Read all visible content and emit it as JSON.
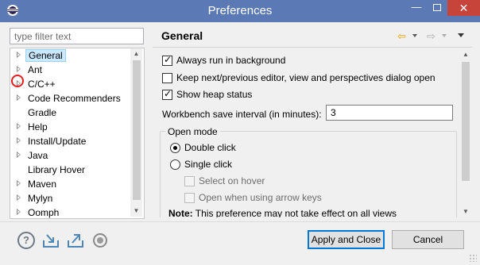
{
  "window": {
    "title": "Preferences",
    "minimize": "—",
    "close": "✕"
  },
  "filter": {
    "placeholder": "type filter text"
  },
  "tree": {
    "items": [
      {
        "label": "General",
        "expandable": true,
        "selected": true
      },
      {
        "label": "Ant",
        "expandable": true
      },
      {
        "label": "C/C++",
        "expandable": true
      },
      {
        "label": "Code Recommenders",
        "expandable": true
      },
      {
        "label": "Gradle",
        "expandable": false
      },
      {
        "label": "Help",
        "expandable": true
      },
      {
        "label": "Install/Update",
        "expandable": true
      },
      {
        "label": "Java",
        "expandable": true
      },
      {
        "label": "Library Hover",
        "expandable": false
      },
      {
        "label": "Maven",
        "expandable": true
      },
      {
        "label": "Mylyn",
        "expandable": true
      },
      {
        "label": "Oomph",
        "expandable": true
      }
    ]
  },
  "page": {
    "title": "General",
    "back_icon": "⇦",
    "forward_icon": "⇨",
    "options": {
      "always_run_background": {
        "label": "Always run in background",
        "checked": true
      },
      "keep_next_prev": {
        "label": "Keep next/previous editor, view and perspectives dialog open",
        "checked": false
      },
      "show_heap": {
        "label": "Show heap status",
        "checked": true
      }
    },
    "save_interval": {
      "label": "Workbench save interval (in minutes):",
      "value": "3"
    },
    "open_mode": {
      "title": "Open mode",
      "double_click": "Double click",
      "single_click": "Single click",
      "select_on_hover": "Select on hover",
      "open_arrow_keys": "Open when using arrow keys",
      "selected": "double_click",
      "note_bold": "Note:",
      "note_text": " This preference may not take effect on all views"
    }
  },
  "footer": {
    "help_icon": "?",
    "apply_close": "Apply and Close",
    "cancel": "Cancel"
  },
  "colors": {
    "titlebar": "#5b79b4",
    "close": "#c7443a",
    "selection": "#cce8ff",
    "annotation_ring": "#e02020"
  }
}
